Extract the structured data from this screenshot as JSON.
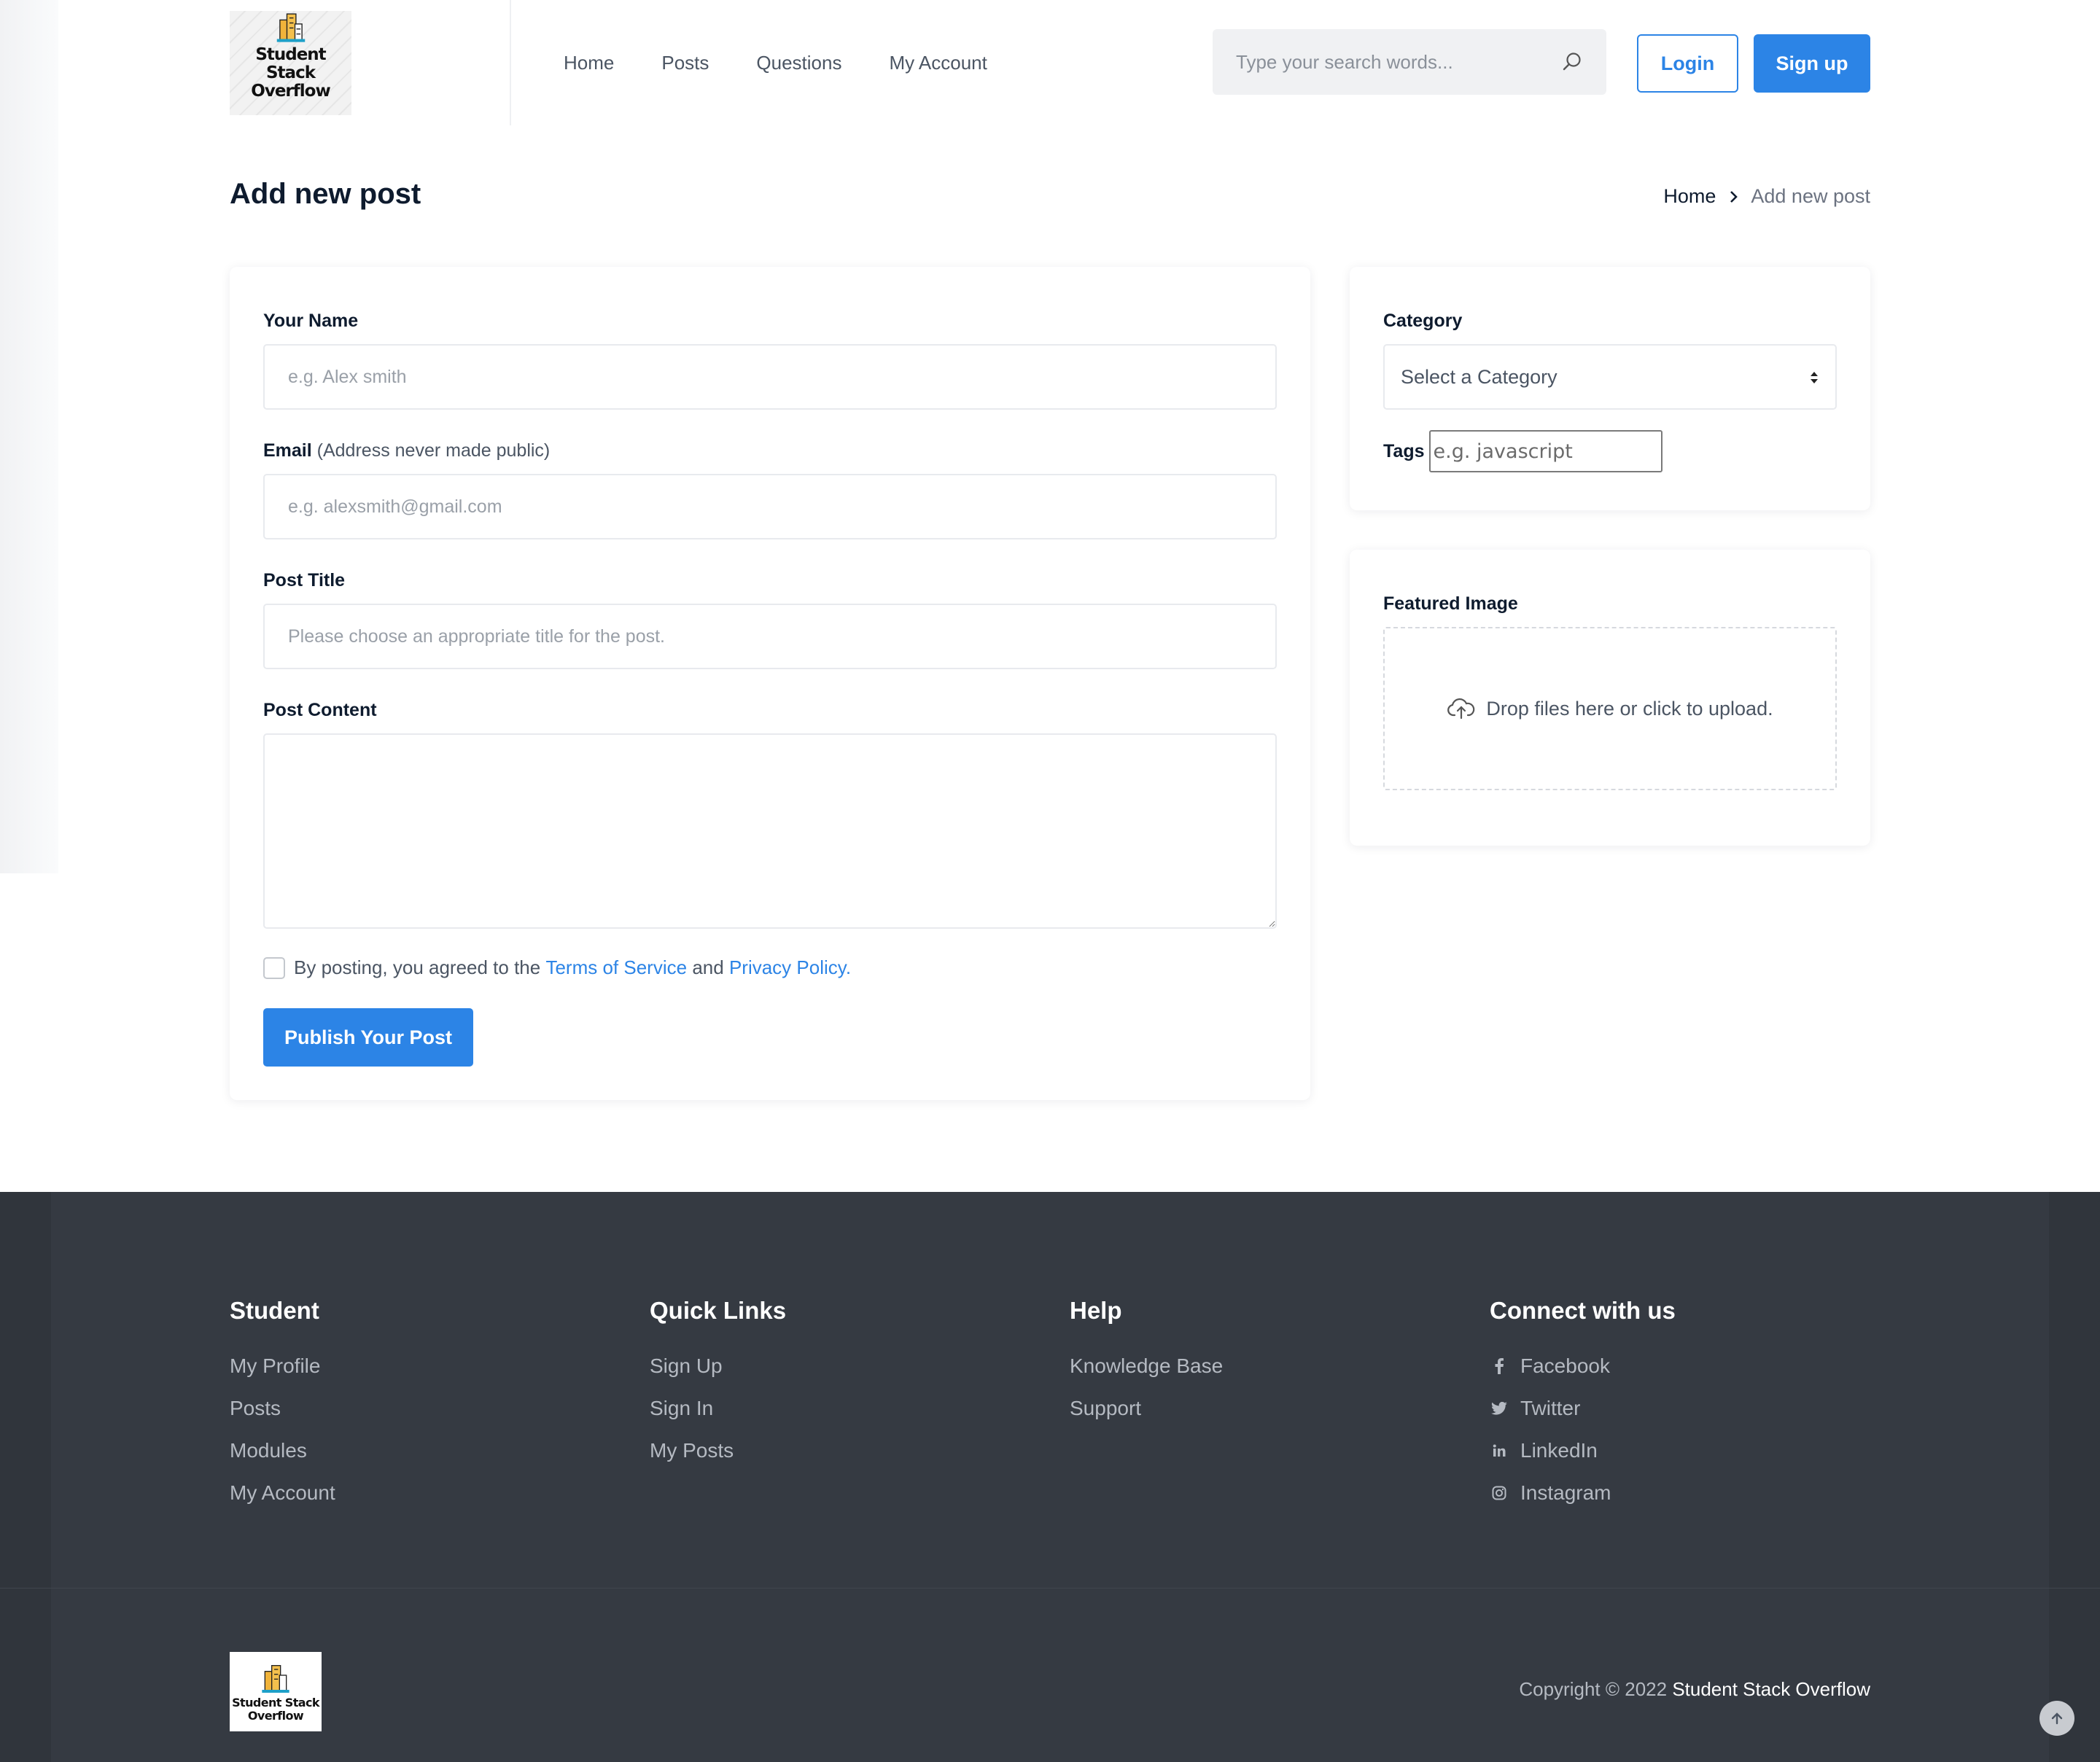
{
  "brand": {
    "logo_text_line1": "Student Stack",
    "logo_text_line2": "Overflow"
  },
  "nav": {
    "items": [
      "Home",
      "Posts",
      "Questions",
      "My Account"
    ]
  },
  "search": {
    "placeholder": "Type your search words..."
  },
  "auth": {
    "login_label": "Login",
    "signup_label": "Sign up"
  },
  "page": {
    "title": "Add new post",
    "breadcrumb": {
      "home": "Home",
      "current": "Add new post"
    }
  },
  "form": {
    "name_label": "Your Name",
    "name_placeholder": "e.g. Alex smith",
    "email_label": "Email",
    "email_note": "(Address never made public)",
    "email_placeholder": "e.g. alexsmith@gmail.com",
    "title_label": "Post Title",
    "title_placeholder": "Please choose an appropriate title for the post.",
    "content_label": "Post Content",
    "content_value": "",
    "agree_prefix": "By posting, you agreed to the",
    "terms_link": "Terms of Service",
    "agree_and": "and",
    "privacy_link": "Privacy Policy.",
    "agree_checked": false,
    "publish_label": "Publish Your Post"
  },
  "sidebar": {
    "category_label": "Category",
    "category_selected": "Select a Category",
    "tags_label": "Tags",
    "tags_placeholder": "e.g. javascript",
    "featured_label": "Featured Image",
    "dropzone_text": "Drop files here or click to upload."
  },
  "footer": {
    "columns": [
      {
        "title": "Student",
        "links": [
          "My Profile",
          "Posts",
          "Modules",
          "My Account"
        ]
      },
      {
        "title": "Quick Links",
        "links": [
          "Sign Up",
          "Sign In",
          "My Posts"
        ]
      },
      {
        "title": "Help",
        "links": [
          "Knowledge Base",
          "Support"
        ]
      },
      {
        "title": "Connect with us",
        "links": [
          "Facebook",
          "Twitter",
          "LinkedIn",
          "Instagram"
        ]
      }
    ],
    "social_icons": [
      "facebook-icon",
      "twitter-icon",
      "linkedin-icon",
      "instagram-icon"
    ],
    "copyright_prefix": "Copyright © 2022",
    "copyright_brand": "Student Stack Overflow"
  },
  "colors": {
    "accent": "#2c84e6",
    "footer_bg": "#353a42",
    "text_dark": "#0e1b2e"
  }
}
